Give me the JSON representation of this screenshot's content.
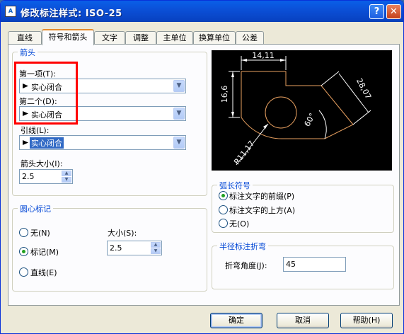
{
  "window": {
    "title": "修改标注样式: ISO-25",
    "icon_text": "A",
    "help_symbol": "?",
    "close_symbol": "✕"
  },
  "tabs": [
    "直线",
    "符号和箭头",
    "文字",
    "调整",
    "主单位",
    "换算单位",
    "公差"
  ],
  "active_tab": 1,
  "arrows": {
    "group_label": "箭头",
    "first_label": "第一项(T):",
    "first_value": "实心闭合",
    "second_label": "第二个(D):",
    "second_value": "实心闭合",
    "leader_label": "引线(L):",
    "leader_value": "实心闭合",
    "size_label": "箭头大小(I):",
    "size_value": "2.5"
  },
  "center_mark": {
    "group_label": "圆心标记",
    "options": [
      "无(N)",
      "标记(M)",
      "直线(E)"
    ],
    "selected": 1,
    "size_label": "大小(S):",
    "size_value": "2.5"
  },
  "arc_length": {
    "group_label": "弧长符号",
    "options": [
      "标注文字的前缀(P)",
      "标注文字的上方(A)",
      "无(O)"
    ],
    "selected": 0
  },
  "radius_jog": {
    "group_label": "半径标注折弯",
    "angle_label": "折弯角度(J):",
    "angle_value": "45"
  },
  "preview": {
    "dim_top": "14,11",
    "dim_left": "16,6",
    "dim_right": "28,07",
    "dim_angle": "60°",
    "dim_radius": "R11,17"
  },
  "buttons": {
    "ok": "确定",
    "cancel": "取消",
    "help": "帮助(H)"
  },
  "colors": {
    "accent": "#0046d5",
    "highlight": "#316ac5",
    "annotation": "#ff0000",
    "preview_geometry": "#e8a060",
    "preview_dims": "#ffffff"
  }
}
